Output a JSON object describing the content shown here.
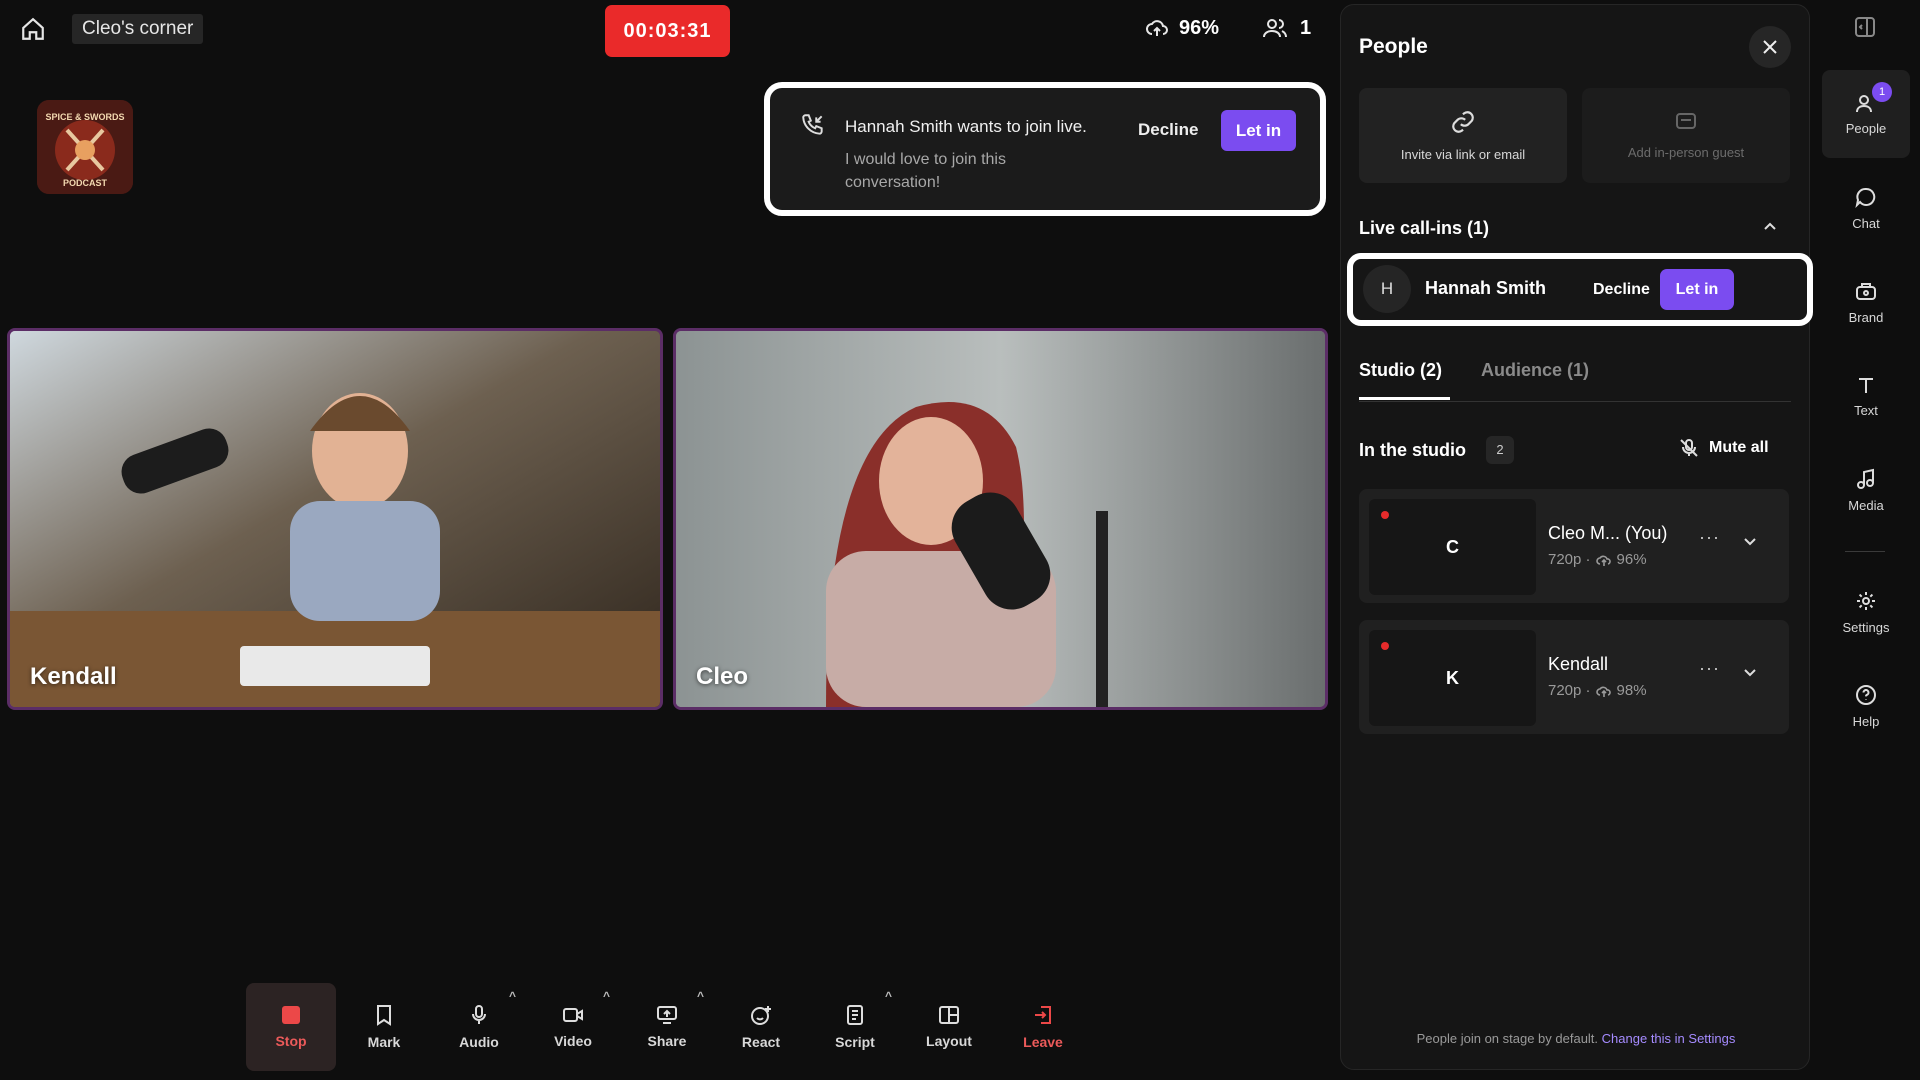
{
  "topbar": {
    "studio_name": "Cleo's corner",
    "timer": "00:03:31",
    "upload_quality": "96%",
    "participant_count": "1"
  },
  "logo": {
    "text_top": "SPICE & SWORDS",
    "text_bottom": "PODCAST"
  },
  "notification": {
    "title": "Hannah Smith wants to join live.",
    "message": "I would love to join this conversation!",
    "decline_label": "Decline",
    "letin_label": "Let in"
  },
  "tiles": [
    {
      "name": "Kendall"
    },
    {
      "name": "Cleo"
    }
  ],
  "toolbar": {
    "stop": "Stop",
    "mark": "Mark",
    "audio": "Audio",
    "video": "Video",
    "share": "Share",
    "react": "React",
    "script": "Script",
    "layout": "Layout",
    "leave": "Leave"
  },
  "panel": {
    "title": "People",
    "invite_label": "Invite via link or email",
    "guest_label": "Add in-person guest",
    "live_title": "Live call-ins (1)",
    "callin": {
      "initial": "H",
      "name": "Hannah Smith",
      "decline": "Decline",
      "letin": "Let in"
    },
    "tabs": {
      "studio": "Studio (2)",
      "audience": "Audience (1)"
    },
    "studio_title": "In the studio",
    "studio_count": "2",
    "mute_all": "Mute all",
    "participants": [
      {
        "initial": "C",
        "name": "Cleo M...  (You)",
        "res": "720p ·",
        "quality": "96%"
      },
      {
        "initial": "K",
        "name": "Kendall",
        "res": "720p ·",
        "quality": "98%"
      }
    ],
    "footer_text": "People join on stage by default.",
    "footer_link": "Change this in Settings"
  },
  "rail": {
    "people": "People",
    "people_badge": "1",
    "chat": "Chat",
    "brand": "Brand",
    "text": "Text",
    "media": "Media",
    "settings": "Settings",
    "help": "Help"
  },
  "colors": {
    "accent": "#7b4cf0",
    "record_red": "#ea2a2a",
    "background": "#0e0e0e"
  }
}
